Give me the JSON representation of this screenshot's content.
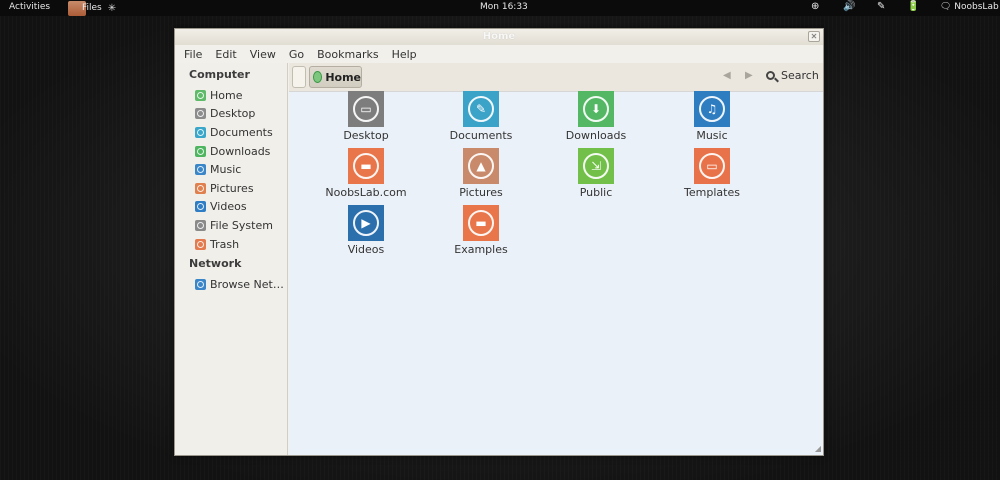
{
  "topbar": {
    "activities": "Activities",
    "app_label": "Files",
    "spinner": "✳",
    "clock": "Mon 16:33",
    "indicators": [
      "⊕",
      "🔊",
      "✎",
      "🔋"
    ],
    "user": "🗨 NoobsLab"
  },
  "window": {
    "title": "Home",
    "close_glyph": "✕",
    "menu": [
      "File",
      "Edit",
      "View",
      "Go",
      "Bookmarks",
      "Help"
    ],
    "toolbar": {
      "path_home": "Home",
      "back_glyph": "◀",
      "forward_glyph": "▶",
      "search_label": "Search"
    },
    "sidebar": {
      "computer_heading": "Computer",
      "computer_items": [
        {
          "label": "Home",
          "icon": "home-icon",
          "color": "#5fba6a"
        },
        {
          "label": "Desktop",
          "icon": "desktop-icon",
          "color": "#8c8c8c"
        },
        {
          "label": "Documents",
          "icon": "documents-icon",
          "color": "#3aa6c9"
        },
        {
          "label": "Downloads",
          "icon": "downloads-icon",
          "color": "#4fb560"
        },
        {
          "label": "Music",
          "icon": "music-icon",
          "color": "#3b86c8"
        },
        {
          "label": "Pictures",
          "icon": "pictures-icon",
          "color": "#e0804e"
        },
        {
          "label": "Videos",
          "icon": "videos-icon",
          "color": "#2f7dc4"
        },
        {
          "label": "File System",
          "icon": "filesystem-icon",
          "color": "#8a8a8a"
        },
        {
          "label": "Trash",
          "icon": "trash-icon",
          "color": "#e37b4e"
        }
      ],
      "network_heading": "Network",
      "network_items": [
        {
          "label": "Browse Net…",
          "icon": "network-icon",
          "color": "#3b86c8"
        }
      ]
    },
    "grid": [
      {
        "label": "Desktop",
        "icon": "desktop-icon",
        "color": "#7d7d7d",
        "glyph": "▭"
      },
      {
        "label": "Documents",
        "icon": "documents-icon",
        "color": "#3ca3c8",
        "glyph": "✎"
      },
      {
        "label": "Downloads",
        "icon": "downloads-icon",
        "color": "#53b764",
        "glyph": "⬇"
      },
      {
        "label": "Music",
        "icon": "music-icon",
        "color": "#2f7dc1",
        "glyph": "♫"
      },
      {
        "label": "NoobsLab.com",
        "icon": "folder-icon",
        "color": "#e8764a",
        "glyph": "▬"
      },
      {
        "label": "Pictures",
        "icon": "pictures-icon",
        "color": "#c88a6a",
        "glyph": "▲"
      },
      {
        "label": "Public",
        "icon": "public-icon",
        "color": "#72c04a",
        "glyph": "⇲"
      },
      {
        "label": "Templates",
        "icon": "templates-icon",
        "color": "#e8734a",
        "glyph": "▭"
      },
      {
        "label": "Videos",
        "icon": "videos-icon",
        "color": "#2c6fad",
        "glyph": "▶"
      },
      {
        "label": "Examples",
        "icon": "examples-link-icon",
        "color": "#e8764a",
        "glyph": "▬"
      }
    ]
  }
}
